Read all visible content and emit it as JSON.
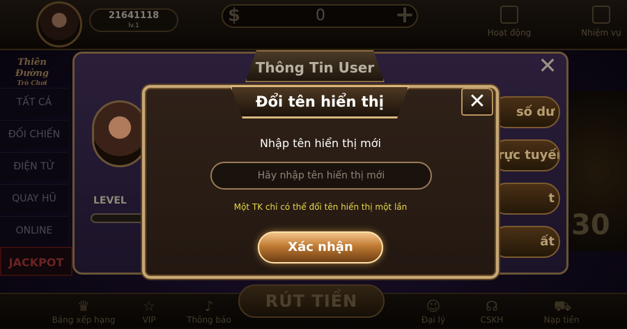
{
  "topbar": {
    "user_id": "21641118",
    "user_level": "lv.1",
    "balance": "0",
    "nav": [
      {
        "label": "Hoạt động",
        "icon": "gift-icon"
      },
      {
        "label": "Nhiệm vụ",
        "icon": "task-icon"
      }
    ]
  },
  "sidebar": {
    "brand_line1": "Thiên Đường",
    "brand_line2": "Trò Chơi",
    "items": [
      "TẤT CẢ",
      "ĐỐI CHIẾN",
      "ĐIỆN TỬ",
      "QUAY HŨ",
      "ONLINE"
    ],
    "jackpot": "JACKPOT"
  },
  "bottombar": {
    "withdraw": "RÚT TIỀN",
    "items": [
      {
        "label": "Bảng xếp hạng",
        "icon": "trophy-icon"
      },
      {
        "label": "VIP",
        "icon": "star-icon"
      },
      {
        "label": "Thông báo",
        "icon": "bell-icon"
      },
      {
        "label": "Đại lý",
        "icon": "agent-icon"
      },
      {
        "label": "CSKH",
        "icon": "headset-icon"
      },
      {
        "label": "Nạp tiền",
        "icon": "cart-icon"
      }
    ]
  },
  "info_panel": {
    "title": "Thông Tin User",
    "level_label": "LEVEL",
    "buttons": [
      "số dư",
      "trực tuyến",
      "t",
      "ất"
    ]
  },
  "background_game_number": "30",
  "dialog": {
    "title": "Đổi tên hiển thị",
    "prompt": "Nhập tên hiển thị mới",
    "input_placeholder": "Hãy nhập tên hiển thị mới",
    "input_value": "",
    "note": "Một TK chỉ có thể đổi tên hiển thị một lần",
    "confirm": "Xác nhận"
  }
}
